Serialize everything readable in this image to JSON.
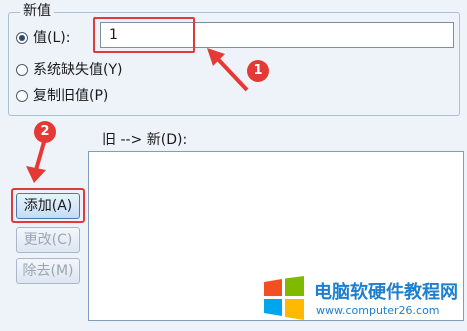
{
  "group": {
    "title": "新值"
  },
  "options": [
    {
      "label": "值(L):",
      "checked": true
    },
    {
      "label": "系统缺失值(Y)",
      "checked": false
    },
    {
      "label": "复制旧值(P)",
      "checked": false
    }
  ],
  "value_input": {
    "value": "1"
  },
  "list": {
    "label": "旧 --> 新(D):"
  },
  "buttons": {
    "add": "添加(A)",
    "change": "更改(C)",
    "remove": "除去(M)"
  },
  "annotations": {
    "step1": "1",
    "step2": "2",
    "accent": "#e53935"
  },
  "watermark": {
    "title": "电脑软硬件教程网",
    "url": "www.computer26.com"
  }
}
